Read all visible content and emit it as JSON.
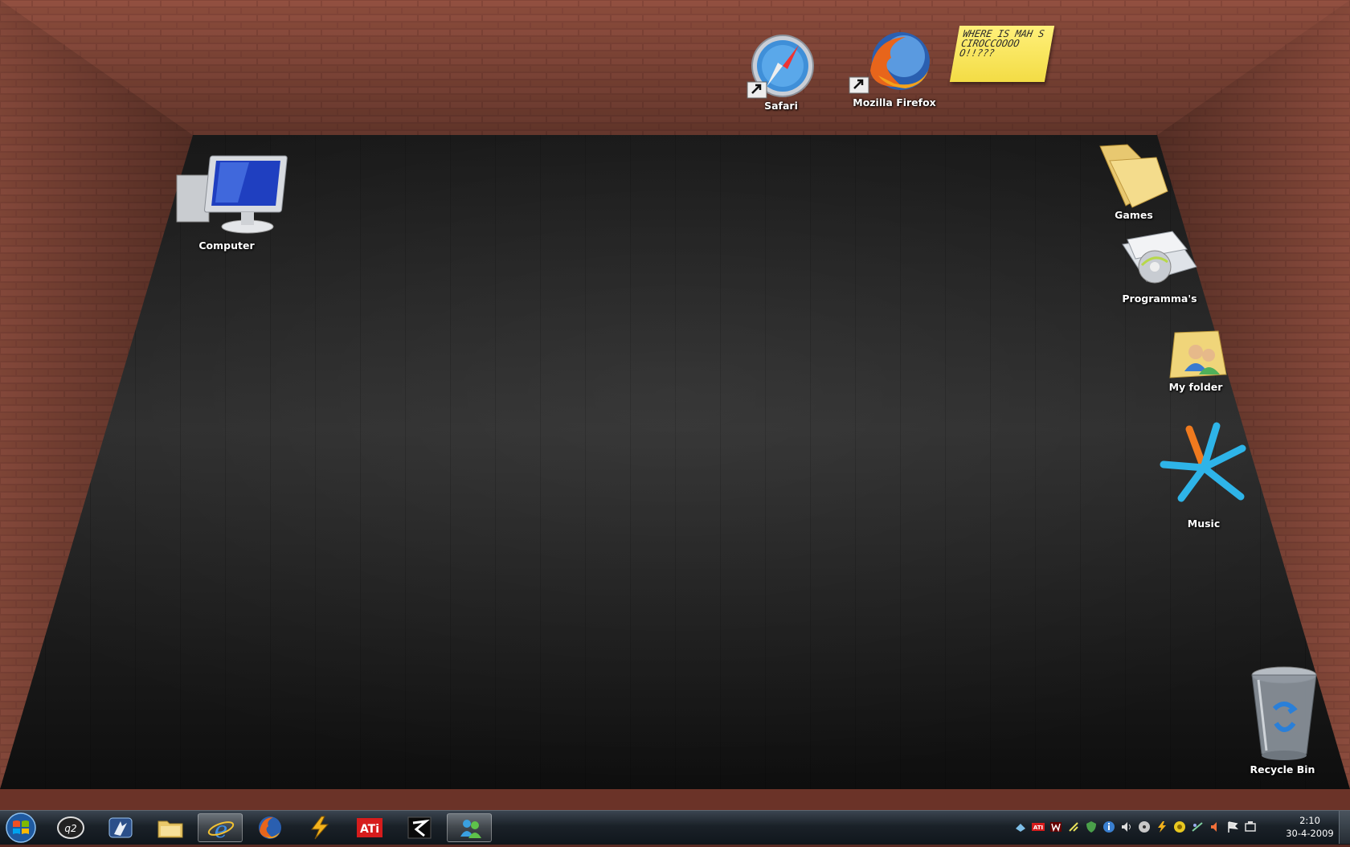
{
  "desktop": {
    "icons": {
      "safari": {
        "label": "Safari",
        "icon": "safari-compass-icon"
      },
      "firefox": {
        "label": "Mozilla Firefox",
        "icon": "firefox-icon"
      },
      "computer": {
        "label": "Computer",
        "icon": "computer-monitor-icon"
      },
      "games": {
        "label": "Games",
        "icon": "folder-icon"
      },
      "programs": {
        "label": "Programma's",
        "icon": "programs-folder-icon"
      },
      "my_folder": {
        "label": "My folder",
        "icon": "user-folder-icon"
      },
      "music": {
        "label": "Music",
        "icon": "music-star-icon"
      },
      "recycle_bin": {
        "label": "Recycle Bin",
        "icon": "recycle-bin-icon"
      }
    },
    "sticky_note": {
      "text": "WHERE IS MAH SCIROCCOOOOO!!???"
    }
  },
  "taskbar": {
    "start": {
      "icon": "windows-start-orb-icon"
    },
    "pinned": [
      {
        "name": "q2-app",
        "icon": "q2-app-icon"
      },
      {
        "name": "app-2",
        "icon": "app-icon"
      },
      {
        "name": "explorer",
        "icon": "folder-icon"
      },
      {
        "name": "internet-explorer",
        "icon": "ie-icon",
        "active": true
      },
      {
        "name": "firefox",
        "icon": "firefox-icon"
      },
      {
        "name": "winamp",
        "icon": "lightning-icon"
      },
      {
        "name": "ati",
        "icon": "ati-logo-icon",
        "text": "ATi"
      },
      {
        "name": "app-8",
        "icon": "app-icon"
      },
      {
        "name": "messenger",
        "icon": "messenger-icon"
      }
    ],
    "tray_icons": [
      "network-icon",
      "ati-icon",
      "w-icon",
      "antenna-icon",
      "shield-icon",
      "info-icon",
      "volume-icon",
      "disc-icon",
      "lightning-icon",
      "coin-icon",
      "network-status-icon",
      "speaker-icon",
      "flag-icon",
      "action-center-icon"
    ],
    "tray_ati_text": "ATI",
    "clock": {
      "time": "2:10",
      "date": "30-4-2009"
    }
  },
  "colors": {
    "brick": "#8b4538",
    "floor": "#1e1e1e",
    "taskbar": "#1a2128",
    "sticky": "#f7e35a"
  }
}
